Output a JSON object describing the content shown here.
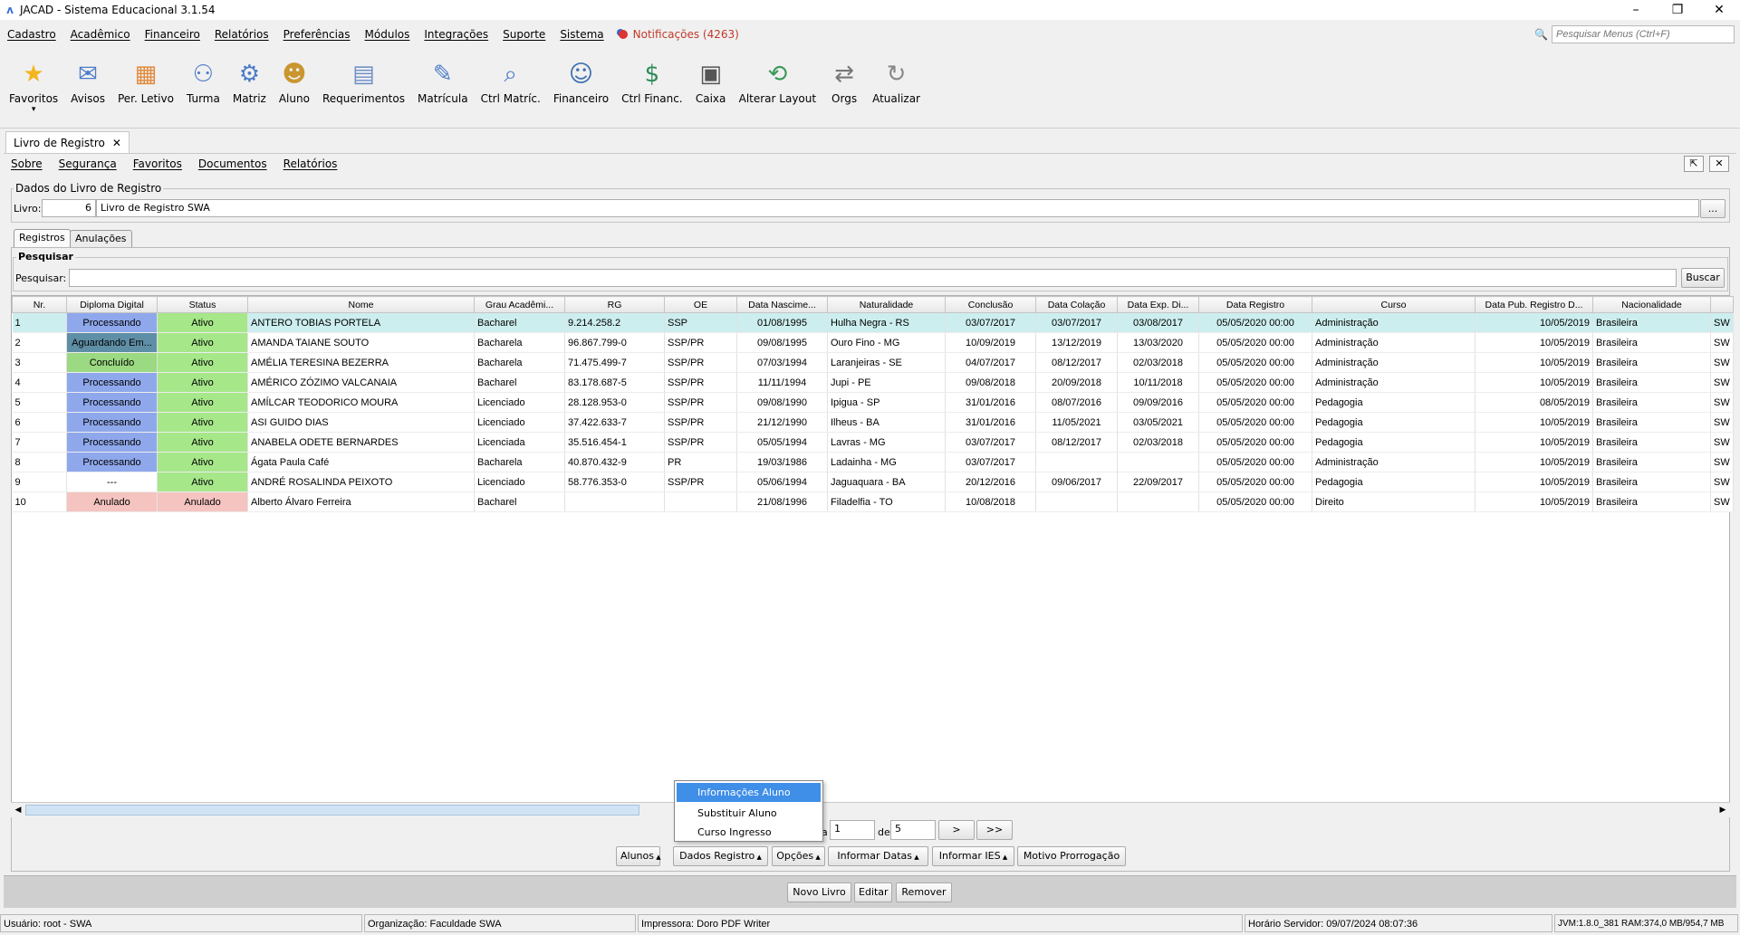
{
  "window": {
    "title": "JACAD - Sistema Educacional 3.1.54",
    "logo": "ʌ"
  },
  "menu": [
    "Cadastro",
    "Acadêmico",
    "Financeiro",
    "Relatórios",
    "Preferências",
    "Módulos",
    "Integrações",
    "Suporte",
    "Sistema"
  ],
  "notifications": "Notificações (4263)",
  "menu_search_placeholder": "Pesquisar Menus (Ctrl+F)",
  "toolbar": [
    {
      "label": "Favoritos",
      "icon": "star-icon",
      "glyph": "★",
      "color": "#f2b51d"
    },
    {
      "label": "Avisos",
      "icon": "envelope-icon",
      "glyph": "✉",
      "color": "#4c7cc9"
    },
    {
      "label": "Per. Letivo",
      "icon": "calendar-icon",
      "glyph": "▦",
      "color": "#e08a3c"
    },
    {
      "label": "Turma",
      "icon": "group-icon",
      "glyph": "⚇",
      "color": "#4c7cc9"
    },
    {
      "label": "Matriz",
      "icon": "matrix-icon",
      "glyph": "⚙",
      "color": "#4c7cc9"
    },
    {
      "label": "Aluno",
      "icon": "student-icon",
      "glyph": "☻",
      "color": "#c9962f"
    },
    {
      "label": "Requerimentos",
      "icon": "request-icon",
      "glyph": "▤",
      "color": "#6b8cc7"
    },
    {
      "label": "Matrícula",
      "icon": "enrollment-icon",
      "glyph": "✎",
      "color": "#4c7cc9"
    },
    {
      "label": "Ctrl Matríc.",
      "icon": "search-doc-icon",
      "glyph": "⌕",
      "color": "#4c7cc9"
    },
    {
      "label": "Financeiro",
      "icon": "finance-user-icon",
      "glyph": "☺",
      "color": "#3d6fb0"
    },
    {
      "label": "Ctrl Financ.",
      "icon": "money-hand-icon",
      "glyph": "$",
      "color": "#2e8b57"
    },
    {
      "label": "Caixa",
      "icon": "cash-register-icon",
      "glyph": "▣",
      "color": "#555555"
    },
    {
      "label": "Alterar Layout",
      "icon": "layout-refresh-icon",
      "glyph": "⟲",
      "color": "#3a9a5a"
    },
    {
      "label": "Orgs",
      "icon": "swap-icon",
      "glyph": "⇄",
      "color": "#777777"
    },
    {
      "label": "Atualizar",
      "icon": "refresh-icon",
      "glyph": "↻",
      "color": "#888888"
    }
  ],
  "doc_tab": "Livro de Registro",
  "submenu": [
    "Sobre",
    "Segurança",
    "Favoritos",
    "Documentos",
    "Relatórios"
  ],
  "dados": {
    "legend": "Dados do Livro de Registro",
    "livro_label": "Livro:",
    "livro_num": "6",
    "livro_name": "Livro de Registro SWA",
    "ellipsis": "..."
  },
  "tabs": [
    "Registros",
    "Anulações"
  ],
  "pesquisar": {
    "legend": "Pesquisar",
    "label": "Pesquisar:",
    "value": "",
    "button": "Buscar"
  },
  "columns": [
    "Nr.",
    "Diploma Digital",
    "Status",
    "Nome",
    "Grau Acadêmi...",
    "RG",
    "OE",
    "Data Nascime...",
    "Naturalidade",
    "Conclusão",
    "Data Colação",
    "Data Exp. Di...",
    "Data Registro",
    "Curso",
    "Data Pub. Registro D...",
    "Nacionalidade",
    ""
  ],
  "rows": [
    [
      "1",
      "Processando",
      "Ativo",
      "ANTERO TOBIAS PORTELA",
      "Bacharel",
      "9.214.258.2",
      "SSP",
      "01/08/1995",
      "Hulha Negra - RS",
      "03/07/2017",
      "03/07/2017",
      "03/08/2017",
      "05/05/2020 00:00",
      "Administração",
      "10/05/2019",
      "Brasileira",
      "SW"
    ],
    [
      "2",
      "Aguardando Em...",
      "Ativo",
      "AMANDA TAIANE SOUTO",
      "Bacharela",
      "96.867.799-0",
      "SSP/PR",
      "09/08/1995",
      "Ouro Fino - MG",
      "10/09/2019",
      "13/12/2019",
      "13/03/2020",
      "05/05/2020 00:00",
      "Administração",
      "10/05/2019",
      "Brasileira",
      "SW"
    ],
    [
      "3",
      "Concluído",
      "Ativo",
      "AMÉLIA TERESINA BEZERRA",
      "Bacharela",
      "71.475.499-7",
      "SSP/PR",
      "07/03/1994",
      "Laranjeiras - SE",
      "04/07/2017",
      "08/12/2017",
      "02/03/2018",
      "05/05/2020 00:00",
      "Administração",
      "10/05/2019",
      "Brasileira",
      "SW"
    ],
    [
      "4",
      "Processando",
      "Ativo",
      "AMÉRICO ZÓZIMO VALCANAIA",
      "Bacharel",
      "83.178.687-5",
      "SSP/PR",
      "11/11/1994",
      "Jupi - PE",
      "09/08/2018",
      "20/09/2018",
      "10/11/2018",
      "05/05/2020 00:00",
      "Administração",
      "10/05/2019",
      "Brasileira",
      "SW"
    ],
    [
      "5",
      "Processando",
      "Ativo",
      "AMÍLCAR TEODORICO MOURA",
      "Licenciado",
      "28.128.953-0",
      "SSP/PR",
      "09/08/1990",
      "Ipigua - SP",
      "31/01/2016",
      "08/07/2016",
      "09/09/2016",
      "05/05/2020 00:00",
      "Pedagogia",
      "08/05/2019",
      "Brasileira",
      "SW"
    ],
    [
      "6",
      "Processando",
      "Ativo",
      "ASI GUIDO DIAS",
      "Licenciado",
      "37.422.633-7",
      "SSP/PR",
      "21/12/1990",
      "Ilheus - BA",
      "31/01/2016",
      "11/05/2021",
      "03/05/2021",
      "05/05/2020 00:00",
      "Pedagogia",
      "10/05/2019",
      "Brasileira",
      "SW"
    ],
    [
      "7",
      "Processando",
      "Ativo",
      "ANABELA ODETE BERNARDES",
      "Licenciada",
      "35.516.454-1",
      "SSP/PR",
      "05/05/1994",
      "Lavras - MG",
      "03/07/2017",
      "08/12/2017",
      "02/03/2018",
      "05/05/2020 00:00",
      "Pedagogia",
      "10/05/2019",
      "Brasileira",
      "SW"
    ],
    [
      "8",
      "Processando",
      "Ativo",
      "Ágata Paula Café",
      "Bacharela",
      "40.870.432-9",
      "PR",
      "19/03/1986",
      "Ladainha - MG",
      "03/07/2017",
      "",
      "",
      "05/05/2020 00:00",
      "Administração",
      "10/05/2019",
      "Brasileira",
      "SW"
    ],
    [
      "9",
      "---",
      "Ativo",
      "ANDRÉ ROSALINDA PEIXOTO",
      "Licenciado",
      "58.776.353-0",
      "SSP/PR",
      "05/06/1994",
      "Jaguaquara - BA",
      "20/12/2016",
      "09/06/2017",
      "22/09/2017",
      "05/05/2020 00:00",
      "Pedagogia",
      "10/05/2019",
      "Brasileira",
      "SW"
    ],
    [
      "10",
      "Anulado",
      "Anulado",
      "Alberto Álvaro Ferreira",
      "Bacharel",
      "",
      "",
      "21/08/1996",
      "Filadelfia - TO",
      "10/08/2018",
      "",
      "",
      "05/05/2020 00:00",
      "Direito",
      "10/05/2019",
      "Brasileira",
      "SW"
    ]
  ],
  "pager": {
    "prefix": "a",
    "page": "1",
    "of": "de",
    "total": "5",
    "next": ">",
    "last": ">>"
  },
  "popup": [
    "Informações Aluno",
    "Substituir Aluno",
    "Curso Ingresso"
  ],
  "action_buttons": [
    "Alunos",
    "Dados Registro",
    "Opções",
    "Informar Datas",
    "Informar IES",
    "Motivo Prorrogação"
  ],
  "bottom_buttons": [
    "Novo Livro",
    "Editar",
    "Remover"
  ],
  "status": {
    "user": "Usuário: root - SWA",
    "org": "Organização: Faculdade SWA",
    "printer": "Impressora: Doro PDF Writer",
    "server_time": "Horário Servidor: 09/07/2024 08:07:36",
    "jvm": "JVM:1.8.0_381  RAM:374,0 MB/954,7 MB"
  }
}
